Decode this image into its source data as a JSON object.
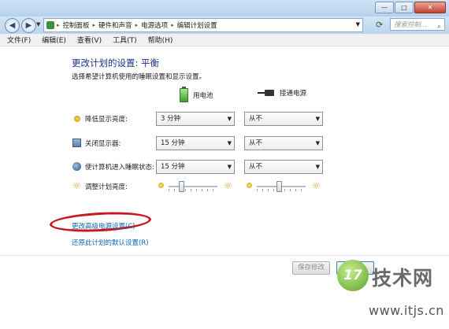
{
  "window": {
    "controls": {
      "minimize": "—",
      "maximize": "□",
      "close": "✕"
    }
  },
  "addressbar": {
    "back_glyph": "◀",
    "forward_glyph": "▶",
    "dropdown_glyph": "▼",
    "crumbs": [
      "控制面板",
      "硬件和声音",
      "电源选项",
      "编辑计划设置"
    ],
    "separator": "▸",
    "refresh_glyph": "⟳",
    "search_placeholder": "搜索控制...",
    "search_glyph": "⌕"
  },
  "menu": {
    "items": [
      "文件(F)",
      "编辑(E)",
      "查看(V)",
      "工具(T)",
      "帮助(H)"
    ]
  },
  "plan": {
    "title": "更改计划的设置: 平衡",
    "subtitle": "选择希望计算机使用的睡眠设置和显示设置。",
    "col_battery": "用电池",
    "col_plugged": "接通电源",
    "dropdown_glyph": "▼",
    "rows": [
      {
        "label": "降低显示亮度:",
        "battery": "3 分钟",
        "plugged": "从不"
      },
      {
        "label": "关闭显示器:",
        "battery": "15 分钟",
        "plugged": "从不"
      },
      {
        "label": "使计算机进入睡眠状态:",
        "battery": "15 分钟",
        "plugged": "从不"
      }
    ],
    "brightness": {
      "label": "调整计划亮度:",
      "max_glyph": "☼",
      "battery_level": 0.25,
      "plugged_level": 0.45
    },
    "link_advanced": "更改高级电源设置(C)",
    "link_restore": "还原此计划的默认设置(R)",
    "save_label": "保存修改",
    "cancel_label": "取消"
  },
  "watermark": {
    "logo": "17",
    "title": "技术网",
    "url": "www.itjs.cn"
  },
  "colors": {
    "heading": "#1e3287",
    "link": "#0b66b3",
    "highlight_ellipse": "#c8181e"
  }
}
